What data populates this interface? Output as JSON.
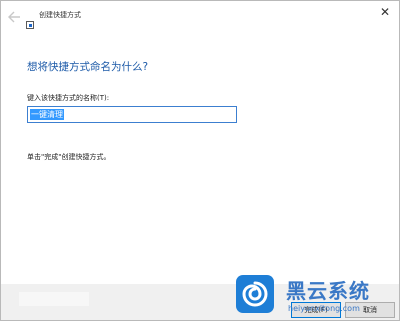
{
  "window": {
    "title": "创建快捷方式",
    "back_icon": "back-arrow-icon",
    "close_icon": "close-icon",
    "close_glyph": "✕"
  },
  "main": {
    "heading": "想将快捷方式命名为什么?",
    "field_label": "键入该快捷方式的名称(T):",
    "name_value": "一键清理",
    "hint": "单击\"完成\"创建快捷方式。"
  },
  "footer": {
    "next_label": "完成(F)",
    "cancel_label": "取消"
  },
  "watermark": {
    "name": "黑云系统",
    "url": "heiyunxitong.com",
    "logo_icon": "spiral-logo-icon"
  },
  "colors": {
    "heading": "#1c5aa8",
    "selection": "#3399ff",
    "input_border": "#3c7fd0",
    "footer_bg": "#f0f0f0",
    "watermark": "#1e7ed6"
  }
}
